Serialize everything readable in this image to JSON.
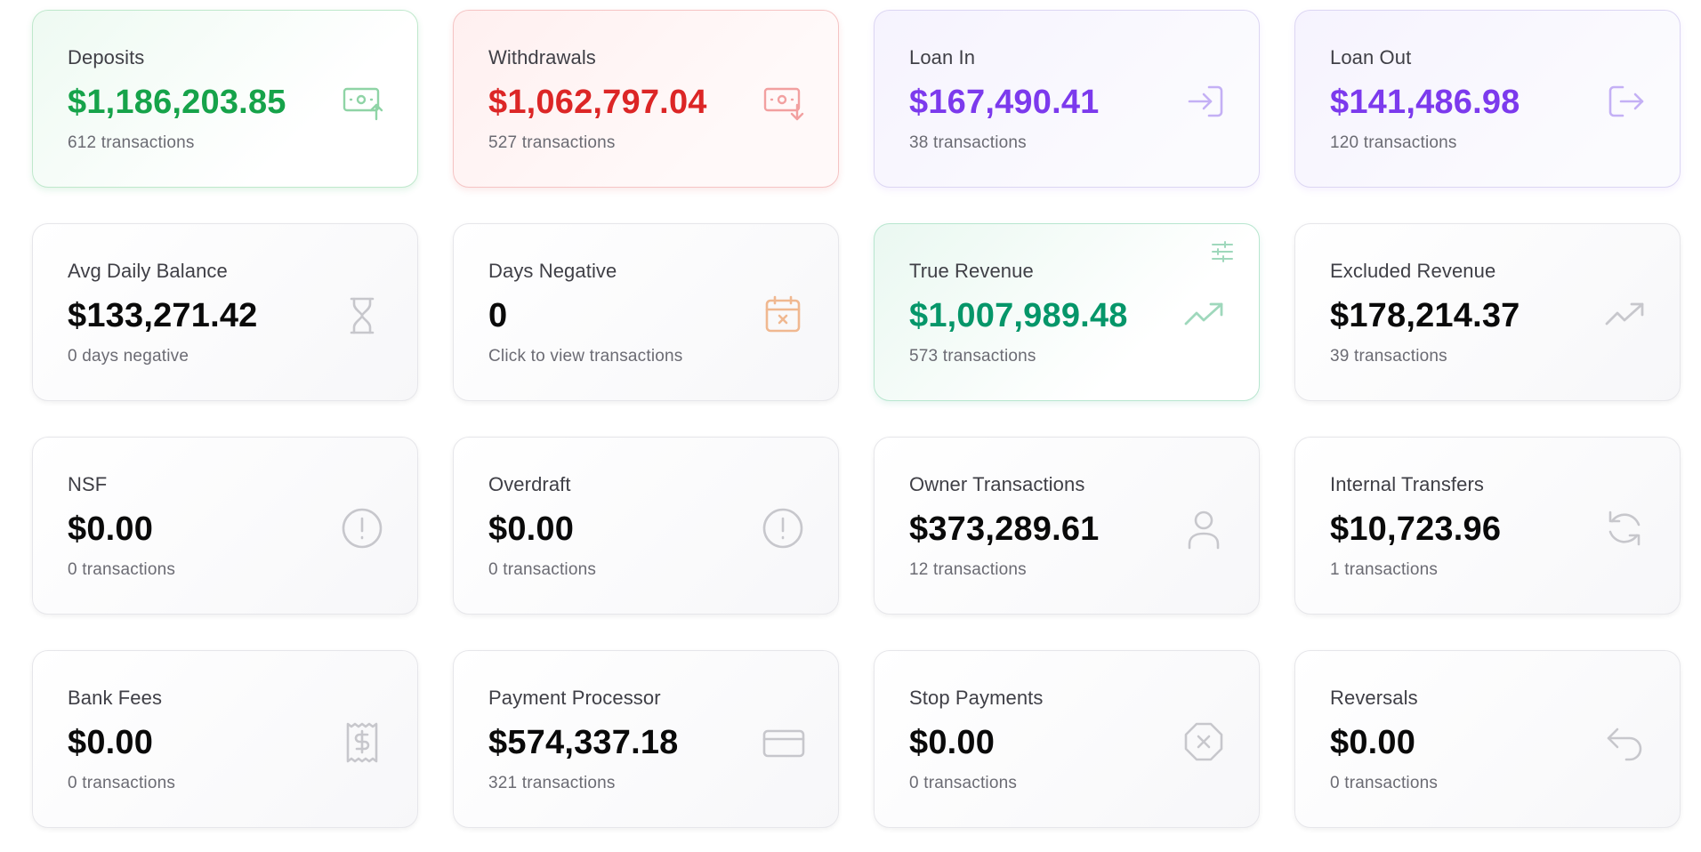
{
  "colors": {
    "green": "#16a34a",
    "red": "#dc2626",
    "purple": "#7c3aed",
    "teal": "#059669",
    "neutral_icon": "#c7c7cc",
    "orange_icon": "#f0a878"
  },
  "cards": [
    {
      "label": "Deposits",
      "value": "$1,186,203.85",
      "sub": "612 transactions",
      "icon": "cash-in-icon"
    },
    {
      "label": "Withdrawals",
      "value": "$1,062,797.04",
      "sub": "527 transactions",
      "icon": "cash-out-icon"
    },
    {
      "label": "Loan In",
      "value": "$167,490.41",
      "sub": "38 transactions",
      "icon": "login-icon"
    },
    {
      "label": "Loan Out",
      "value": "$141,486.98",
      "sub": "120 transactions",
      "icon": "logout-icon"
    },
    {
      "label": "Avg Daily Balance",
      "value": "$133,271.42",
      "sub": "0 days negative",
      "icon": "hourglass-icon"
    },
    {
      "label": "Days Negative",
      "value": "0",
      "sub": "Click to view transactions",
      "icon": "calendar-x-icon"
    },
    {
      "label": "True Revenue",
      "value": "$1,007,989.48",
      "sub": "573 transactions",
      "icon": "trending-up-icon"
    },
    {
      "label": "Excluded Revenue",
      "value": "$178,214.37",
      "sub": "39 transactions",
      "icon": "trending-up-icon"
    },
    {
      "label": "NSF",
      "value": "$0.00",
      "sub": "0 transactions",
      "icon": "alert-circle-icon"
    },
    {
      "label": "Overdraft",
      "value": "$0.00",
      "sub": "0 transactions",
      "icon": "alert-circle-icon"
    },
    {
      "label": "Owner Transactions",
      "value": "$373,289.61",
      "sub": "12 transactions",
      "icon": "user-icon"
    },
    {
      "label": "Internal Transfers",
      "value": "$10,723.96",
      "sub": "1 transactions",
      "icon": "refresh-icon"
    },
    {
      "label": "Bank Fees",
      "value": "$0.00",
      "sub": "0 transactions",
      "icon": "receipt-icon"
    },
    {
      "label": "Payment Processor",
      "value": "$574,337.18",
      "sub": "321 transactions",
      "icon": "credit-card-icon"
    },
    {
      "label": "Stop Payments",
      "value": "$0.00",
      "sub": "0 transactions",
      "icon": "octagon-x-icon"
    },
    {
      "label": "Reversals",
      "value": "$0.00",
      "sub": "0 transactions",
      "icon": "undo-icon"
    }
  ]
}
